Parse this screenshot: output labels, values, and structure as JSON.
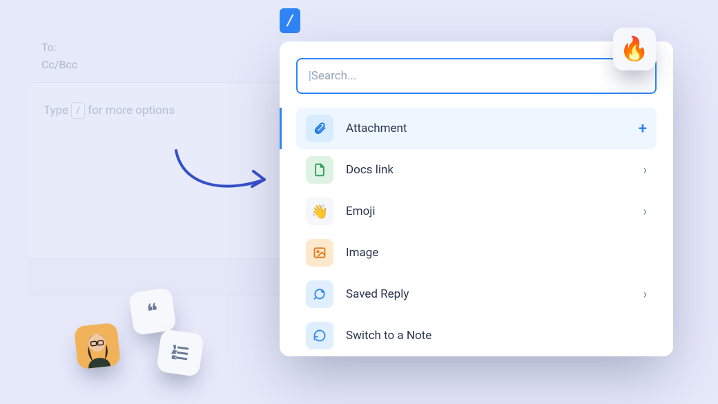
{
  "compose": {
    "to_label": "To:",
    "cc_label": "Cc/Bcc",
    "placeholder_pre": "Type",
    "placeholder_slash": "/",
    "placeholder_post": "for more options"
  },
  "slash_badge": "/",
  "menu": {
    "search_placeholder": "Search...",
    "items": [
      {
        "label": "Attachment",
        "icon": "attachment-icon",
        "tile": "blue",
        "trail": "plus",
        "selected": true
      },
      {
        "label": "Docs link",
        "icon": "document-icon",
        "tile": "green",
        "trail": "chevron",
        "selected": false
      },
      {
        "label": "Emoji",
        "icon": "wave-emoji-icon",
        "tile": "white",
        "trail": "chevron",
        "selected": false
      },
      {
        "label": "Image",
        "icon": "image-icon",
        "tile": "orange",
        "trail": "none",
        "selected": false
      },
      {
        "label": "Saved Reply",
        "icon": "saved-reply-icon",
        "tile": "bluel",
        "trail": "chevron",
        "selected": false
      },
      {
        "label": "Switch to a Note",
        "icon": "refresh-icon",
        "tile": "bluel2",
        "trail": "none",
        "selected": false
      }
    ]
  },
  "float": {
    "fire": "🔥",
    "quote": "❝",
    "wave": "👋"
  }
}
